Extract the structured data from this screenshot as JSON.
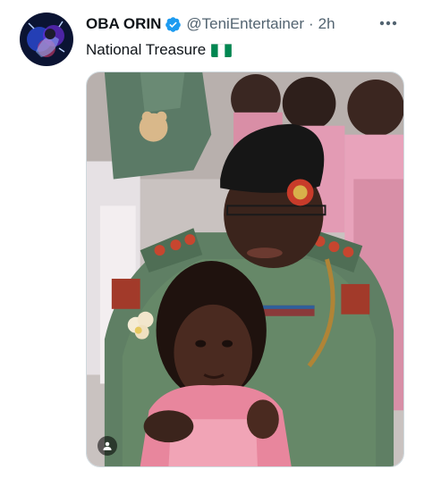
{
  "tweet": {
    "display_name": "OBA ORIN",
    "handle": "@TeniEntertainer",
    "separator": "·",
    "time": "2h",
    "text": "National Treasure",
    "flag_colors": {
      "green": "#008751",
      "white": "#ffffff"
    }
  },
  "icons": {
    "verified": "verified-badge-icon",
    "more": "more-horizontal-icon",
    "tag_people": "person-tag-icon"
  },
  "colors": {
    "verified_blue": "#1d9bf0",
    "secondary_text": "#536471",
    "primary_text": "#0f1419",
    "border": "#cfd9de"
  }
}
